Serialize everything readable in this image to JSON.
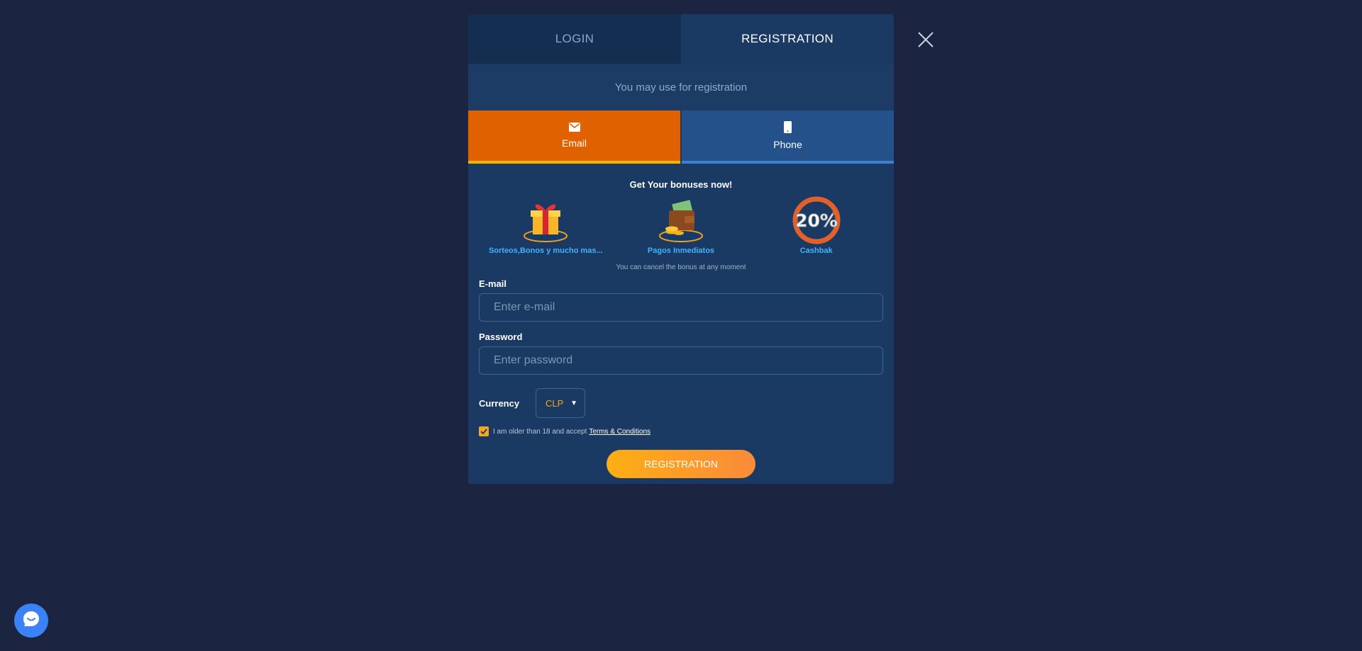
{
  "modal": {
    "tabs": {
      "login": "LOGIN",
      "registration": "REGISTRATION"
    },
    "hint": "You may use for registration",
    "methods": {
      "email": "Email",
      "phone": "Phone"
    },
    "bonus_title": "Get Your bonuses now!",
    "bonuses": [
      {
        "label": "Sorteos,Bonos y mucho mas...",
        "icon": "gift-icon"
      },
      {
        "label": "Pagos Inmediatos",
        "icon": "wallet-icon"
      },
      {
        "label": "Cashbak",
        "icon": "cashback-20-percent-icon"
      }
    ],
    "cashback_badge": "20%",
    "cancel_note": "You can cancel the bonus at any moment",
    "email": {
      "label": "E-mail",
      "placeholder": "Enter e-mail",
      "value": ""
    },
    "password": {
      "label": "Password",
      "placeholder": "Enter password",
      "value": ""
    },
    "currency": {
      "label": "Currency",
      "value": "CLP"
    },
    "terms": {
      "text": "I am older than 18 and accept",
      "link": "Terms & Conditions",
      "checked": true
    },
    "submit_label": "REGISTRATION"
  },
  "colors": {
    "background": "#1b2440",
    "modal": "#1a3a63",
    "accent_orange": "#e06100",
    "accent_yellow": "#f5a623",
    "link_blue": "#3fb3ff"
  }
}
